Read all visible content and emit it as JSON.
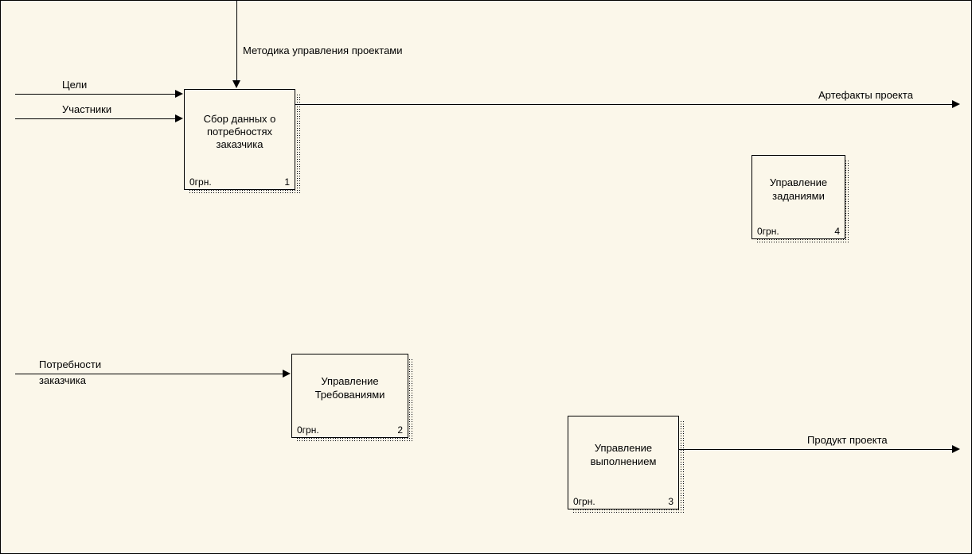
{
  "arrows": {
    "goals": "Цели",
    "participants": "Участники",
    "methodology": "Методика управления проектами",
    "artifacts": "Артефакты проекта",
    "needs_line1": "Потребности",
    "needs_line2": "заказчика",
    "product": "Продукт проекта"
  },
  "blocks": {
    "b1": {
      "title": "Сбор данных о потребностях заказчика",
      "cost": "0грн.",
      "num": "1"
    },
    "b2": {
      "title": "Управление Требованиями",
      "cost": "0грн.",
      "num": "2"
    },
    "b3": {
      "title": "Управление выполнением",
      "cost": "0грн.",
      "num": "3"
    },
    "b4": {
      "title": "Управление заданиями",
      "cost": "0грн.",
      "num": "4"
    }
  }
}
